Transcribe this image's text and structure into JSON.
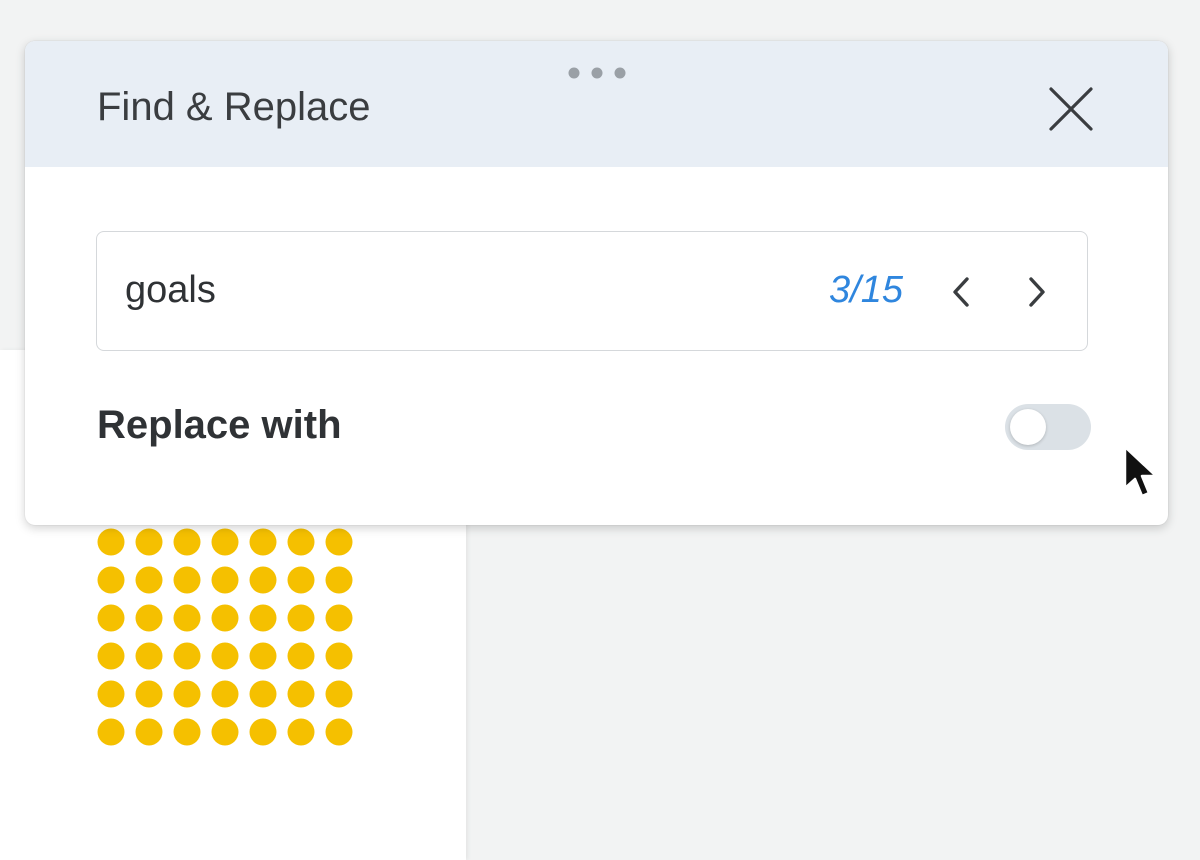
{
  "dialog": {
    "title": "Find & Replace",
    "drag_handle_icon": "more-horizontal-icon",
    "close_icon": "close-icon"
  },
  "search": {
    "value": "goals",
    "match_count": "3/15",
    "prev_icon": "chevron-left-icon",
    "next_icon": "chevron-right-icon"
  },
  "replace": {
    "label": "Replace with",
    "toggle_on": false
  },
  "colors": {
    "header_bg": "#e8eef5",
    "accent_blue": "#2f86de",
    "dot_yellow": "#f5c000",
    "toggle_off": "#dbe1e6"
  },
  "decor": {
    "dot_rows": 6,
    "dot_cols": 7
  }
}
